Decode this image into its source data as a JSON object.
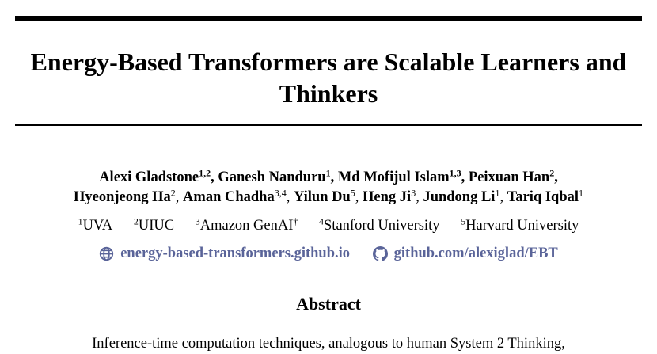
{
  "paper": {
    "title_line1": "Energy-Based Transformers are Scalable Learners and",
    "title_line2": "Thinkers",
    "authors": [
      {
        "name": "Alexi Gladstone",
        "sup": "1,2",
        "bold": true,
        "sep": ", "
      },
      {
        "name": "Ganesh Nanduru",
        "sup": "1",
        "bold": true,
        "sep": ", "
      },
      {
        "name": "Md Mofijul Islam",
        "sup": "1,3",
        "bold": true,
        "sep": ", "
      },
      {
        "name": "Peixuan Han",
        "sup": "2",
        "bold": true,
        "sep": ","
      },
      {
        "name": "Hyeonjeong Ha",
        "sup": "2",
        "bold": true,
        "sep": ", "
      },
      {
        "name": "Aman Chadha",
        "sup": "3,4",
        "bold": true,
        "sep": ", "
      },
      {
        "name": "Yilun Du",
        "sup": "5",
        "bold": true,
        "sep": ", "
      },
      {
        "name": "Heng Ji",
        "sup": "3",
        "bold": true,
        "sep": ", "
      },
      {
        "name": "Jundong Li",
        "sup": "1",
        "bold": true,
        "sep": ", "
      },
      {
        "name": "Tariq Iqbal",
        "sup": "1",
        "bold": true,
        "sep": ""
      }
    ],
    "affiliations": [
      {
        "sup": "1",
        "name": "UVA"
      },
      {
        "sup": "2",
        "name": "UIUC"
      },
      {
        "sup": "3",
        "name": "Amazon GenAI",
        "mark": "†"
      },
      {
        "sup": "4",
        "name": "Stanford University"
      },
      {
        "sup": "5",
        "name": "Harvard University"
      }
    ],
    "links": {
      "website": {
        "label": "energy-based-transformers.github.io",
        "icon": "globe-icon"
      },
      "github": {
        "label": "github.com/alexiglad/EBT",
        "icon": "github-icon"
      }
    },
    "abstract_heading": "Abstract",
    "abstract_first_line": "Inference-time computation techniques, analogous to human System 2 Thinking,"
  },
  "colors": {
    "link": "#5a6499",
    "text": "#000000"
  }
}
